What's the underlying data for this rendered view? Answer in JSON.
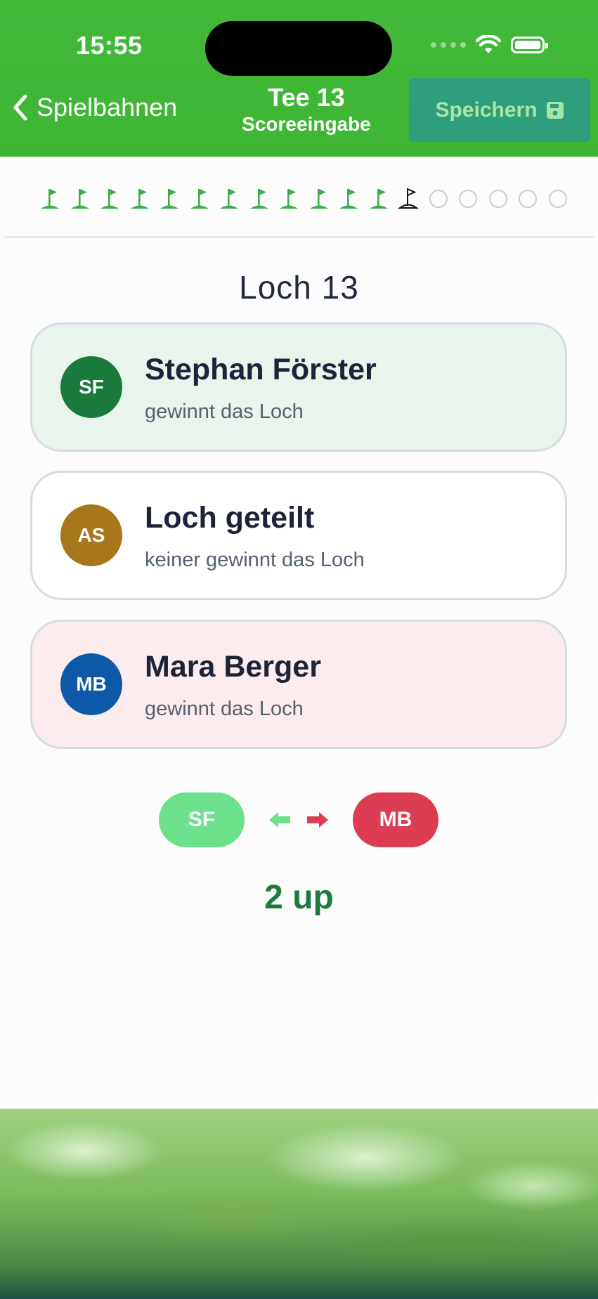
{
  "status_bar": {
    "time": "15:55"
  },
  "nav": {
    "back_label": "Spielbahnen",
    "title": "Tee 13",
    "subtitle": "Scoreeingabe",
    "save_label": "Speichern"
  },
  "hole_progress": {
    "completed": 12,
    "current": 13,
    "total": 18
  },
  "hole_title": "Loch 13",
  "options": [
    {
      "initials": "SF",
      "name": "Stephan Förster",
      "subtitle": "gewinnt das Loch",
      "avatar_color": "#1a7a3c",
      "bg_color": "#e8f4ec"
    },
    {
      "initials": "AS",
      "name": "Loch geteilt",
      "subtitle": "keiner gewinnt das Loch",
      "avatar_color": "#a8771c",
      "bg_color": "#ffffff"
    },
    {
      "initials": "MB",
      "name": "Mara Berger",
      "subtitle": "gewinnt das Loch",
      "avatar_color": "#0f5aa8",
      "bg_color": "#fdeced"
    }
  ],
  "match": {
    "left_initials": "SF",
    "right_initials": "MB",
    "left_color": "#6ce08a",
    "right_color": "#dc3d52",
    "result": "2 up"
  }
}
